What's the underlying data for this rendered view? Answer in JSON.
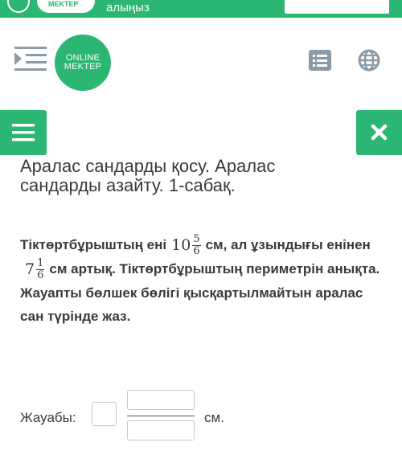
{
  "banner": {
    "logo_text": "MEKTEP",
    "text": "алыңыз"
  },
  "header": {
    "logo_line1": "ONLINE",
    "logo_line2": "MEKTEP",
    "icons": [
      "menu-collapse-icon",
      "list-icon",
      "globe-icon"
    ]
  },
  "buttons": {
    "icons": [
      "hamburger-icon",
      "close-icon"
    ]
  },
  "lesson": {
    "title": "Аралас сандарды қосу. Аралас сандарды азайту. 1-сабақ."
  },
  "problem": {
    "part1": "Тіктөртбұрыштың ені",
    "width_whole": "10",
    "width_num": "5",
    "width_den": "6",
    "part2": "см, ал ұзындығы енінен",
    "diff_whole": "7",
    "diff_num": "1",
    "diff_den": "6",
    "part3": "см артық. Тіктөртбұрыштың периметрін анықта. Жауапты бөлшек бөлігі қысқартылмайтын аралас сан түрінде жаз."
  },
  "answer": {
    "label": "Жауабы:",
    "unit": "см.",
    "whole_value": "",
    "numerator_value": "",
    "denominator_value": ""
  },
  "colors": {
    "brand_green": "#2bb673",
    "icon_gray": "#8a9aa6",
    "text": "#3a3a3a"
  }
}
